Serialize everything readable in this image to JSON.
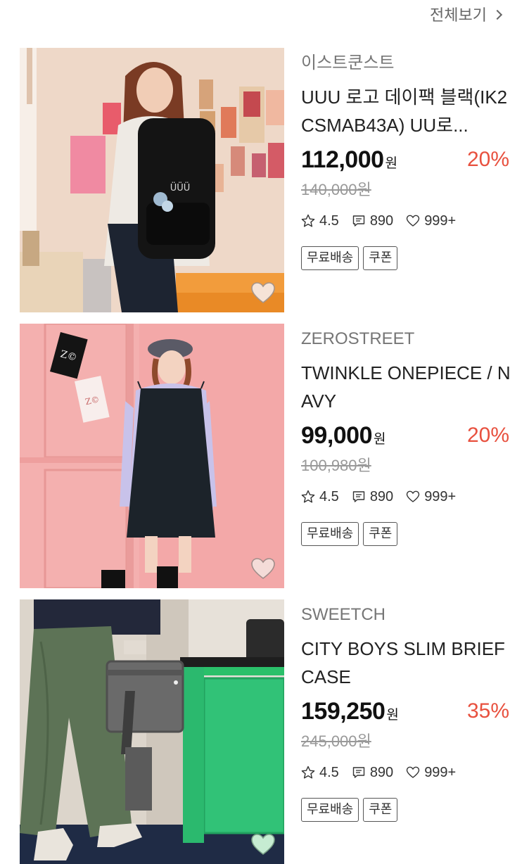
{
  "header": {
    "see_all_label": "전체보기"
  },
  "products": [
    {
      "brand": "이스트쿤스트",
      "name": "UUU 로고 데이팩 블랙(IK2CSMAB43A) UU로...",
      "price": "112,000",
      "currency": "원",
      "discount": "20%",
      "original_price": "140,000원",
      "rating": "4.5",
      "reviews": "890",
      "likes": "999+",
      "tags": [
        "무료배송",
        "쿠폰"
      ]
    },
    {
      "brand": "ZEROSTREET",
      "name": "TWINKLE ONEPIECE / NAVY",
      "price": "99,000",
      "currency": "원",
      "discount": "20%",
      "original_price": "100,980원",
      "rating": "4.5",
      "reviews": "890",
      "likes": "999+",
      "tags": [
        "무료배송",
        "쿠폰"
      ]
    },
    {
      "brand": "SWEETCH",
      "name": "CITY BOYS SLIM BRIEFCASE",
      "price": "159,250",
      "currency": "원",
      "discount": "35%",
      "original_price": "245,000원",
      "rating": "4.5",
      "reviews": "890",
      "likes": "999+",
      "tags": [
        "무료배송",
        "쿠폰"
      ]
    }
  ],
  "colors": {
    "discount": "#e8513f",
    "brand_text": "#767676",
    "tag_border": "#555555",
    "heart_fill_1": "#f6e3d6",
    "heart_fill_2": "#f4dcd8",
    "heart_fill_3": "#c6ecd2"
  },
  "icons": [
    "chevron-right-icon",
    "star-icon",
    "comment-icon",
    "heart-icon",
    "like-heart-icon"
  ]
}
